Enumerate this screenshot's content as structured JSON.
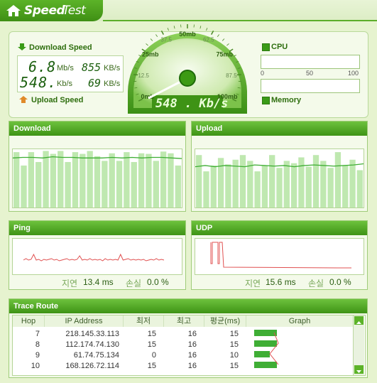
{
  "app": {
    "title_bold": "Speed",
    "title_light": "Test"
  },
  "download": {
    "label": "Download Speed",
    "mbs": "6.8",
    "mbs_unit": "Mb/s",
    "kbs": "855",
    "kbs_unit": "KB/s"
  },
  "upload": {
    "label": "Upload Speed",
    "kbs": "548.",
    "kbs_unit": "Kb/s",
    "KBs": "69",
    "KBs_unit": "KB/s"
  },
  "gauge": {
    "readout": "548 . Kb/s",
    "value_mb": 0.55,
    "ticks": [
      "0mb",
      "12.5",
      "25mb",
      "37.5",
      "50mb",
      "62.5",
      "75mb",
      "87.5",
      "100mb"
    ]
  },
  "cpu": {
    "label": "CPU",
    "scale": [
      "0",
      "50",
      "100"
    ],
    "level": 0
  },
  "memory": {
    "label": "Memory",
    "level": 0
  },
  "panels": {
    "download_title": "Download",
    "upload_title": "Upload",
    "ping_title": "Ping",
    "udp_title": "UDP"
  },
  "ping": {
    "delay_label": "지연",
    "delay": "13.4 ms",
    "loss_label": "손실",
    "loss": "0.0 %"
  },
  "udp": {
    "delay_label": "지연",
    "delay": "15.6 ms",
    "loss_label": "손실",
    "loss": "0.0 %"
  },
  "trace": {
    "title": "Trace Route",
    "headers": [
      "Hop",
      "IP Address",
      "최저",
      "최고",
      "평균(ms)",
      "Graph"
    ],
    "rows": [
      {
        "hop": "7",
        "ip": "218.145.33.113",
        "min": "15",
        "max": "16",
        "avg": "15"
      },
      {
        "hop": "8",
        "ip": "112.174.74.130",
        "min": "15",
        "max": "16",
        "avg": "15"
      },
      {
        "hop": "9",
        "ip": "61.74.75.134",
        "min": "0",
        "max": "16",
        "avg": "10"
      },
      {
        "hop": "10",
        "ip": "168.126.72.114",
        "min": "15",
        "max": "16",
        "avg": "15"
      }
    ]
  },
  "colors": {
    "accent": "#4aa11c",
    "bar": "#bfe8b0",
    "line": "#3fae35",
    "ping_line": "#e05050"
  }
}
